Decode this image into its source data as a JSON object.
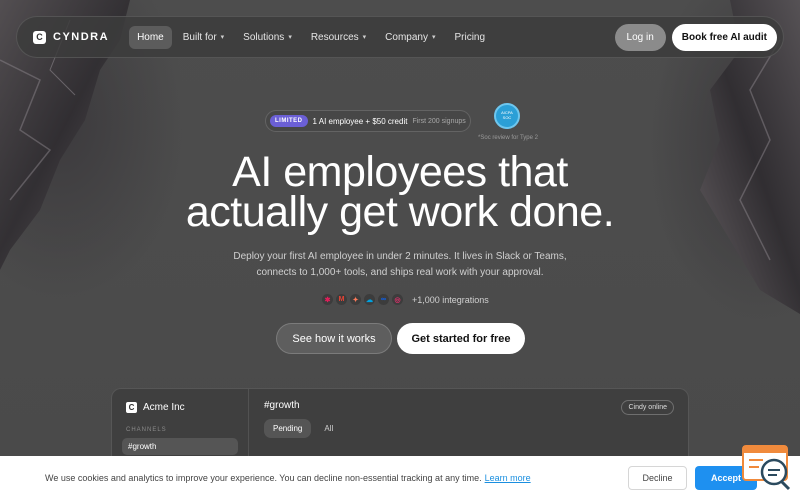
{
  "brand": {
    "name": "CYNDRA",
    "mark": "C"
  },
  "nav": {
    "items": [
      {
        "label": "Home",
        "dropdown": false
      },
      {
        "label": "Built for",
        "dropdown": true
      },
      {
        "label": "Solutions",
        "dropdown": true
      },
      {
        "label": "Resources",
        "dropdown": true
      },
      {
        "label": "Company",
        "dropdown": true
      },
      {
        "label": "Pricing",
        "dropdown": false
      }
    ],
    "login_label": "Log in",
    "audit_label": "Book free AI audit"
  },
  "promo": {
    "tag": "LIMITED",
    "text": "1 AI employee + $50 credit",
    "sub": "First 200 signups"
  },
  "badge": {
    "line1": "AICPA",
    "line2": "SOC",
    "caption": "*Soc review for Type 2"
  },
  "hero": {
    "headline_line1": "AI employees that",
    "headline_line2": "actually get work done.",
    "sub_line1": "Deploy your first AI employee in under 2 minutes. It lives in Slack or Teams,",
    "sub_line2": "connects to 1,000+ tools, and ships real work with your approval.",
    "integrations_text": "+1,000 integrations",
    "secondary_cta": "See how it works",
    "primary_cta": "Get started for free"
  },
  "integration_icons": [
    {
      "name": "slack-icon",
      "glyph": "✱",
      "color": "#e01e5a"
    },
    {
      "name": "gmail-icon",
      "glyph": "M",
      "color": "#ea4335"
    },
    {
      "name": "hubspot-icon",
      "glyph": "✦",
      "color": "#ff7a59"
    },
    {
      "name": "salesforce-icon",
      "glyph": "☁",
      "color": "#00a1e0"
    },
    {
      "name": "meta-icon",
      "glyph": "∞",
      "color": "#0866ff"
    },
    {
      "name": "instagram-icon",
      "glyph": "◎",
      "color": "#e1306c"
    }
  ],
  "app": {
    "workspace": "Acme Inc",
    "workspace_mark": "C",
    "channels_heading": "CHANNELS",
    "active_channel": "#growth",
    "channel_title": "#growth",
    "online_status": "Cindy online",
    "tabs": [
      "Pending",
      "All"
    ]
  },
  "cookie": {
    "text": "We use cookies and analytics to improve your experience. You can decline non-essential tracking at any time.",
    "link": "Learn more",
    "decline": "Decline",
    "accept": "Accept"
  },
  "colors": {
    "accent_purple": "#6b5fd6",
    "accept_blue": "#1e90f0",
    "link_blue": "#1a8fe0"
  }
}
